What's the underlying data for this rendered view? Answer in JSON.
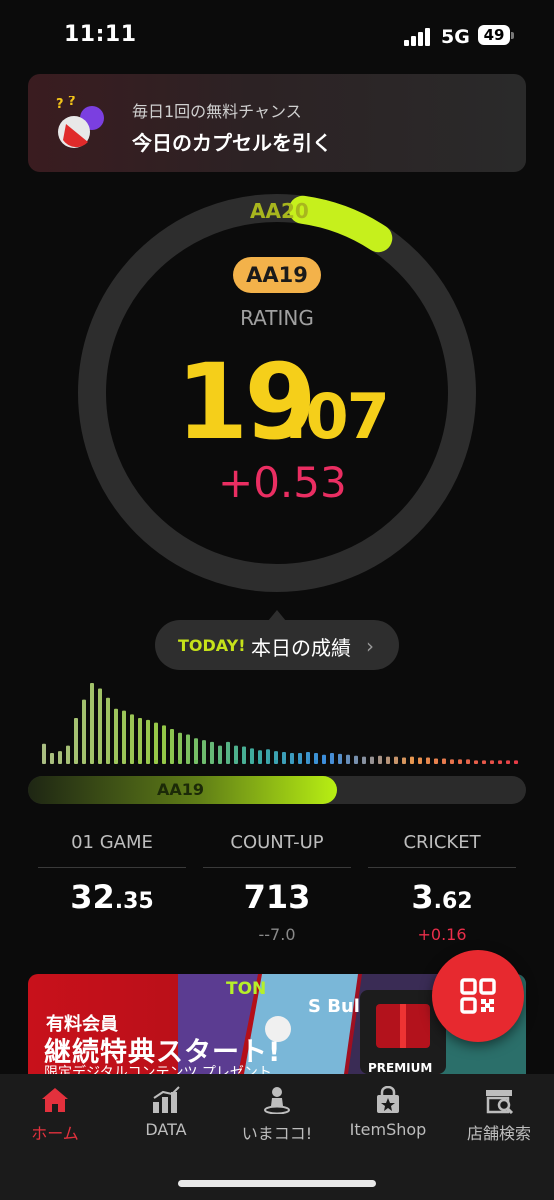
{
  "status_bar": {
    "time": "11:11",
    "network": "5G",
    "battery": "49"
  },
  "capsule_banner": {
    "subtitle": "毎日1回の無料チャンス",
    "title": "今日のカプセルを引く"
  },
  "rating": {
    "next_rank": "AA20",
    "current_rank": "AA19",
    "label": "RATING",
    "value_int": "19",
    "value_dec": ".07",
    "delta": "+0.53",
    "ring_progress": 0.07,
    "colors": {
      "ring_track": "#2d2d2d",
      "ring_fill": "#c6f01c",
      "rating": "#f5cf1a",
      "delta": "#ea2e62"
    }
  },
  "today": {
    "badge": "TODAY!",
    "text": "本日の成績"
  },
  "distribution": {
    "bars": [
      0.22,
      0.12,
      0.14,
      0.2,
      0.5,
      0.7,
      0.88,
      0.82,
      0.72,
      0.6,
      0.58,
      0.54,
      0.5,
      0.48,
      0.45,
      0.42,
      0.38,
      0.34,
      0.32,
      0.28,
      0.26,
      0.24,
      0.2,
      0.24,
      0.2,
      0.19,
      0.17,
      0.15,
      0.16,
      0.14,
      0.13,
      0.12,
      0.12,
      0.13,
      0.12,
      0.1,
      0.12,
      0.11,
      0.1,
      0.09,
      0.08,
      0.08,
      0.09,
      0.08,
      0.08,
      0.07,
      0.08,
      0.07,
      0.07,
      0.06,
      0.06,
      0.05,
      0.05,
      0.05,
      0.04,
      0.04,
      0.04,
      0.04,
      0.04,
      0.04
    ],
    "current_rank_label": "AA19",
    "progress": 0.62
  },
  "stats": [
    {
      "name": "01 GAME",
      "value_int": "32",
      "value_dec": ".35",
      "delta": ""
    },
    {
      "name": "COUNT-UP",
      "value_int": "713",
      "value_dec": "",
      "delta": "--7.0"
    },
    {
      "name": "CRICKET",
      "value_int": "3",
      "value_dec": ".62",
      "delta": "+0.16"
    }
  ],
  "promo": {
    "line1": "有料会員",
    "line2": "継続特典スタート!",
    "line3": "限定デジタルコンテンツ プレゼント",
    "tile_text": "S Bull",
    "tile_text2": "TON",
    "badge": "PREMIUM"
  },
  "tabs": [
    {
      "label": "ホーム",
      "icon": "home-icon",
      "active": true
    },
    {
      "label": "DATA",
      "icon": "data-chart-icon",
      "active": false
    },
    {
      "label": "いまココ!",
      "icon": "location-person-icon",
      "active": false
    },
    {
      "label": "ItemShop",
      "icon": "item-bag-icon",
      "active": false
    },
    {
      "label": "店舗検索",
      "icon": "store-search-icon",
      "active": false
    }
  ]
}
